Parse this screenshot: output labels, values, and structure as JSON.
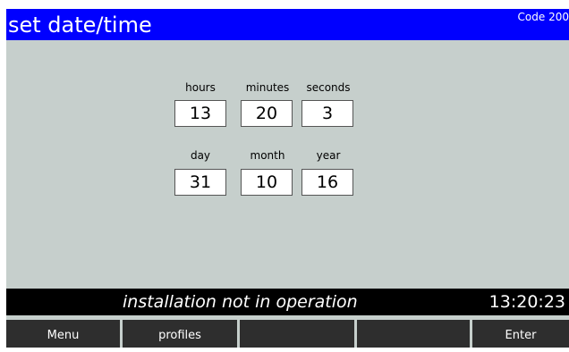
{
  "title": "set date/time",
  "code": "Code 200",
  "time_fields": [
    {
      "label": "hours",
      "value": "13"
    },
    {
      "label": "minutes",
      "value": "20"
    },
    {
      "label": "seconds",
      "value": "3"
    }
  ],
  "date_fields": [
    {
      "label": "day",
      "value": "31"
    },
    {
      "label": "month",
      "value": "10"
    },
    {
      "label": "year",
      "value": "16"
    }
  ],
  "status": {
    "message": "installation not in operation",
    "clock": "13:20:23"
  },
  "softkeys": [
    {
      "label": "Menu"
    },
    {
      "label": "profiles"
    },
    {
      "label": ""
    },
    {
      "label": ""
    },
    {
      "label": "Enter"
    }
  ],
  "colors": {
    "title_bar": "#0000ff",
    "background": "#c6cfcc",
    "status_bar": "#000000",
    "softkey": "#2e2e2e"
  }
}
